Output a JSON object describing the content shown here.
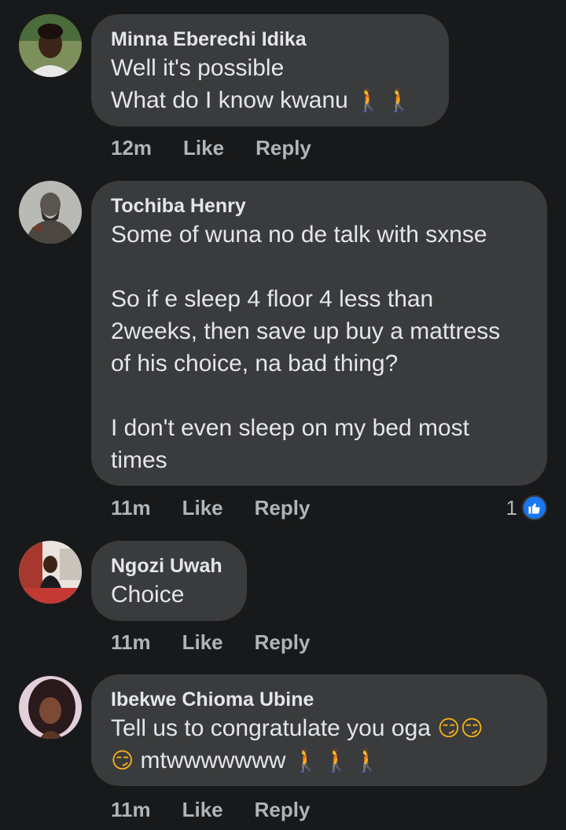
{
  "comments": [
    {
      "author": "Minna Eberechi Idika",
      "lines": [
        "Well it's possible",
        "What do I know kwanu"
      ],
      "line2_emoji": "🚶🚶",
      "time": "12m",
      "like_label": "Like",
      "reply_label": "Reply"
    },
    {
      "author": "Tochiba Henry",
      "lines": [
        "Some of wuna no de talk with sxnse",
        "",
        "So if e sleep 4 floor 4 less than",
        "2weeks, then save up buy a mattress",
        "of his choice, na bad thing?",
        "",
        "I don't even sleep on my bed most",
        "times"
      ],
      "time": "11m",
      "like_label": "Like",
      "reply_label": "Reply",
      "reaction_count": "1",
      "reaction_icon": "thumbs-up-icon"
    },
    {
      "author": "Ngozi Uwah",
      "lines": [
        "Choice"
      ],
      "time": "11m",
      "like_label": "Like",
      "reply_label": "Reply"
    },
    {
      "author": "Ibekwe Chioma Ubine",
      "lines": [
        "Tell us to congratulate you oga",
        "mtwwwwwww"
      ],
      "line1_emoji": "😏😏",
      "line2_prefix_emoji": "😏",
      "line2_emoji": "🚶🚶🚶",
      "time": "11m",
      "like_label": "Like",
      "reply_label": "Reply"
    }
  ],
  "colors": {
    "background": "#18191a",
    "bubble": "#3a3b3c",
    "text": "#e4e6eb",
    "meta": "#b0b3b8",
    "like_badge": "#1877f2"
  }
}
